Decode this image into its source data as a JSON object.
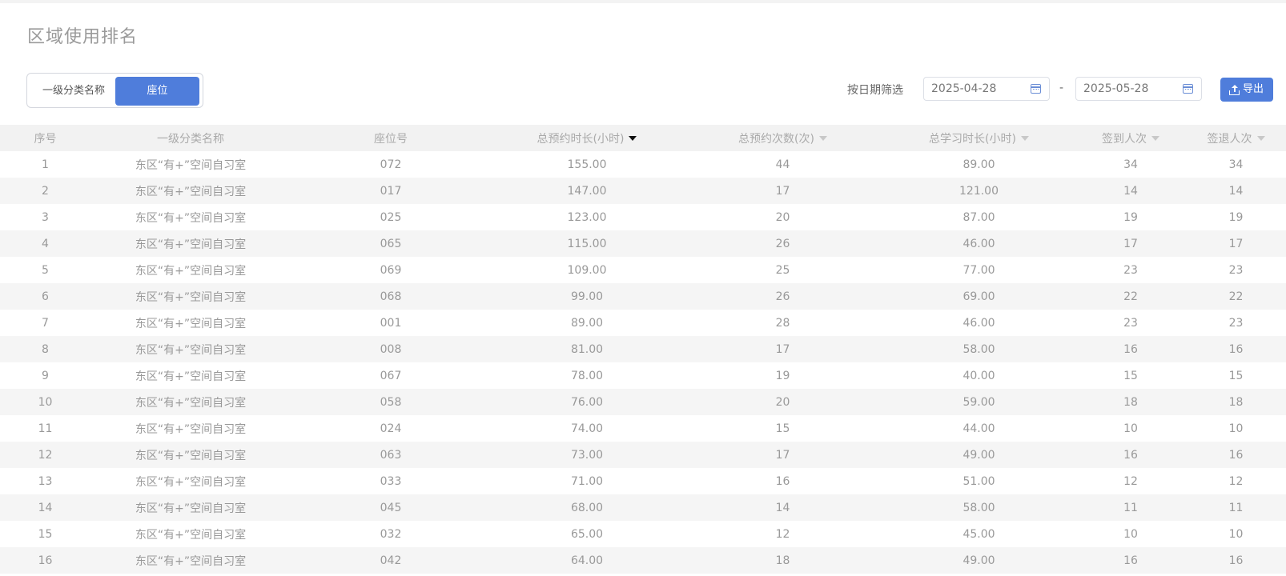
{
  "page": {
    "title": "区域使用排名"
  },
  "toggle": {
    "options": [
      "一级分类名称",
      "座位"
    ],
    "active": "座位"
  },
  "filter": {
    "label": "按日期筛选",
    "start_date": "2025-04-28",
    "separator": "-",
    "end_date": "2025-05-28",
    "icon": "calendar-icon"
  },
  "export": {
    "label": "导出",
    "icon": "upload-icon"
  },
  "colors": {
    "primary": "#4f7ddb",
    "header_bg": "#f2f2f2",
    "stripe_bg": "#f5f5f5",
    "text": "#999999"
  },
  "table": {
    "columns": [
      "序号",
      "一级分类名称",
      "座位号",
      "总预约时长(小时)",
      "总预约次数(次)",
      "总学习时长(小时)",
      "签到人次",
      "签退人次"
    ],
    "sorted_column": "总预约时长(小时)",
    "rows": [
      [
        "1",
        "东区“有+”空间自习室",
        "072",
        "155.00",
        "44",
        "89.00",
        "34",
        "34"
      ],
      [
        "2",
        "东区“有+”空间自习室",
        "017",
        "147.00",
        "17",
        "121.00",
        "14",
        "14"
      ],
      [
        "3",
        "东区“有+”空间自习室",
        "025",
        "123.00",
        "20",
        "87.00",
        "19",
        "19"
      ],
      [
        "4",
        "东区“有+”空间自习室",
        "065",
        "115.00",
        "26",
        "46.00",
        "17",
        "17"
      ],
      [
        "5",
        "东区“有+”空间自习室",
        "069",
        "109.00",
        "25",
        "77.00",
        "23",
        "23"
      ],
      [
        "6",
        "东区“有+”空间自习室",
        "068",
        "99.00",
        "26",
        "69.00",
        "22",
        "22"
      ],
      [
        "7",
        "东区“有+”空间自习室",
        "001",
        "89.00",
        "28",
        "46.00",
        "23",
        "23"
      ],
      [
        "8",
        "东区“有+”空间自习室",
        "008",
        "81.00",
        "17",
        "58.00",
        "16",
        "16"
      ],
      [
        "9",
        "东区“有+”空间自习室",
        "067",
        "78.00",
        "19",
        "40.00",
        "15",
        "15"
      ],
      [
        "10",
        "东区“有+”空间自习室",
        "058",
        "76.00",
        "20",
        "59.00",
        "18",
        "18"
      ],
      [
        "11",
        "东区“有+”空间自习室",
        "024",
        "74.00",
        "15",
        "44.00",
        "10",
        "10"
      ],
      [
        "12",
        "东区“有+”空间自习室",
        "063",
        "73.00",
        "17",
        "49.00",
        "16",
        "16"
      ],
      [
        "13",
        "东区“有+”空间自习室",
        "033",
        "71.00",
        "16",
        "51.00",
        "12",
        "12"
      ],
      [
        "14",
        "东区“有+”空间自习室",
        "045",
        "68.00",
        "14",
        "58.00",
        "11",
        "11"
      ],
      [
        "15",
        "东区“有+”空间自习室",
        "032",
        "65.00",
        "12",
        "45.00",
        "10",
        "10"
      ],
      [
        "16",
        "东区“有+”空间自习室",
        "042",
        "64.00",
        "18",
        "49.00",
        "16",
        "16"
      ]
    ]
  }
}
